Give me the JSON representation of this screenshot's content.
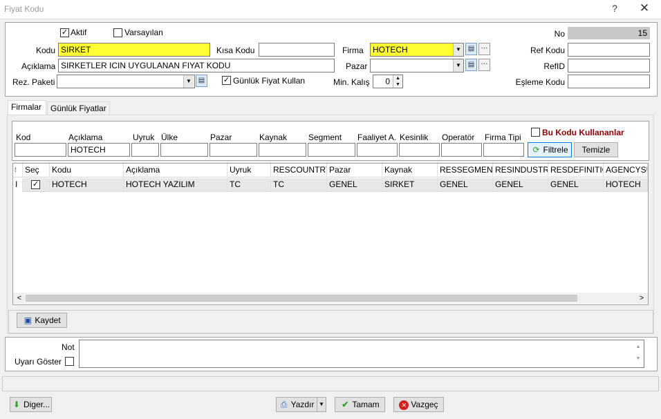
{
  "window": {
    "title": "Fiyat Kodu",
    "help": "?",
    "close": "✕"
  },
  "top": {
    "aktif_label": "Aktif",
    "aktif_checked": "✓",
    "varsayilan_label": "Varsayılan",
    "kodu_label": "Kodu",
    "kodu_value": "SIRKET",
    "kisa_kodu_label": "Kısa Kodu",
    "kisa_kodu_value": "",
    "firma_label": "Firma",
    "firma_value": "HOTECH",
    "no_label": "No",
    "no_value": "15",
    "ref_kodu_label": "Ref Kodu",
    "ref_kodu_value": "",
    "aciklama_label": "Açıklama",
    "aciklama_value": "SIRKETLER ICIN UYGULANAN FIYAT KODU",
    "pazar_label": "Pazar",
    "pazar_value": "",
    "refid_label": "RefID",
    "refid_value": "",
    "rez_paketi_label": "Rez. Paketi",
    "rez_paketi_value": "",
    "gunluk_label": "Günlük Fiyat Kullan",
    "gunluk_checked": "✓",
    "min_kalis_label": "Min. Kalış",
    "min_kalis_value": "0",
    "esleme_kodu_label": "Eşleme Kodu",
    "esleme_kodu_value": ""
  },
  "tabs": [
    "Firmalar",
    "Günlük Fiyatlar"
  ],
  "filter": {
    "labels": [
      "Kod",
      "Açıklama",
      "Uyruk",
      "Ülke",
      "Pazar",
      "Kaynak",
      "Segment",
      "Faaliyet A.",
      "Kesinlik",
      "Operatör",
      "Firma Tipi"
    ],
    "values": [
      "",
      "HOTECH",
      "",
      "",
      "",
      "",
      "",
      "",
      "",
      "",
      ""
    ],
    "bu_kodu_label": "Bu Kodu Kullananlar",
    "filtrele_label": "Filtrele",
    "temizle_label": "Temizle"
  },
  "grid": {
    "columns": [
      "Seç",
      "Kodu",
      "Açıklama",
      "Uyruk",
      "RESCOUNTRY",
      "Pazar",
      "Kaynak",
      "RESSEGMENT",
      "RESINDUSTRY",
      "RESDEFINITION",
      "AGENCYSU"
    ],
    "rows": [
      {
        "indicator": "I",
        "sec": "✓",
        "cells": [
          "HOTECH",
          "HOTECH YAZILIM",
          "TC",
          "TC",
          "GENEL",
          "SIRKET",
          "GENEL",
          "GENEL",
          "GENEL",
          "HOTECH"
        ]
      }
    ],
    "scroll_left": "<",
    "scroll_right": ">"
  },
  "kaydet_label": "Kaydet",
  "note": {
    "not_label": "Not",
    "uyari_label": "Uyarı Göster",
    "value": ""
  },
  "footer": {
    "diger_label": "Diger...",
    "yazdir_label": "Yazdır",
    "tamam_label": "Tamam",
    "vazgec_label": "Vazgeç"
  },
  "colors": {
    "highlight": "#ffff33",
    "tamam_icon": "#2e9e2e",
    "vazgec_icon": "#d42020",
    "bu_kodu": "#8b0000"
  }
}
